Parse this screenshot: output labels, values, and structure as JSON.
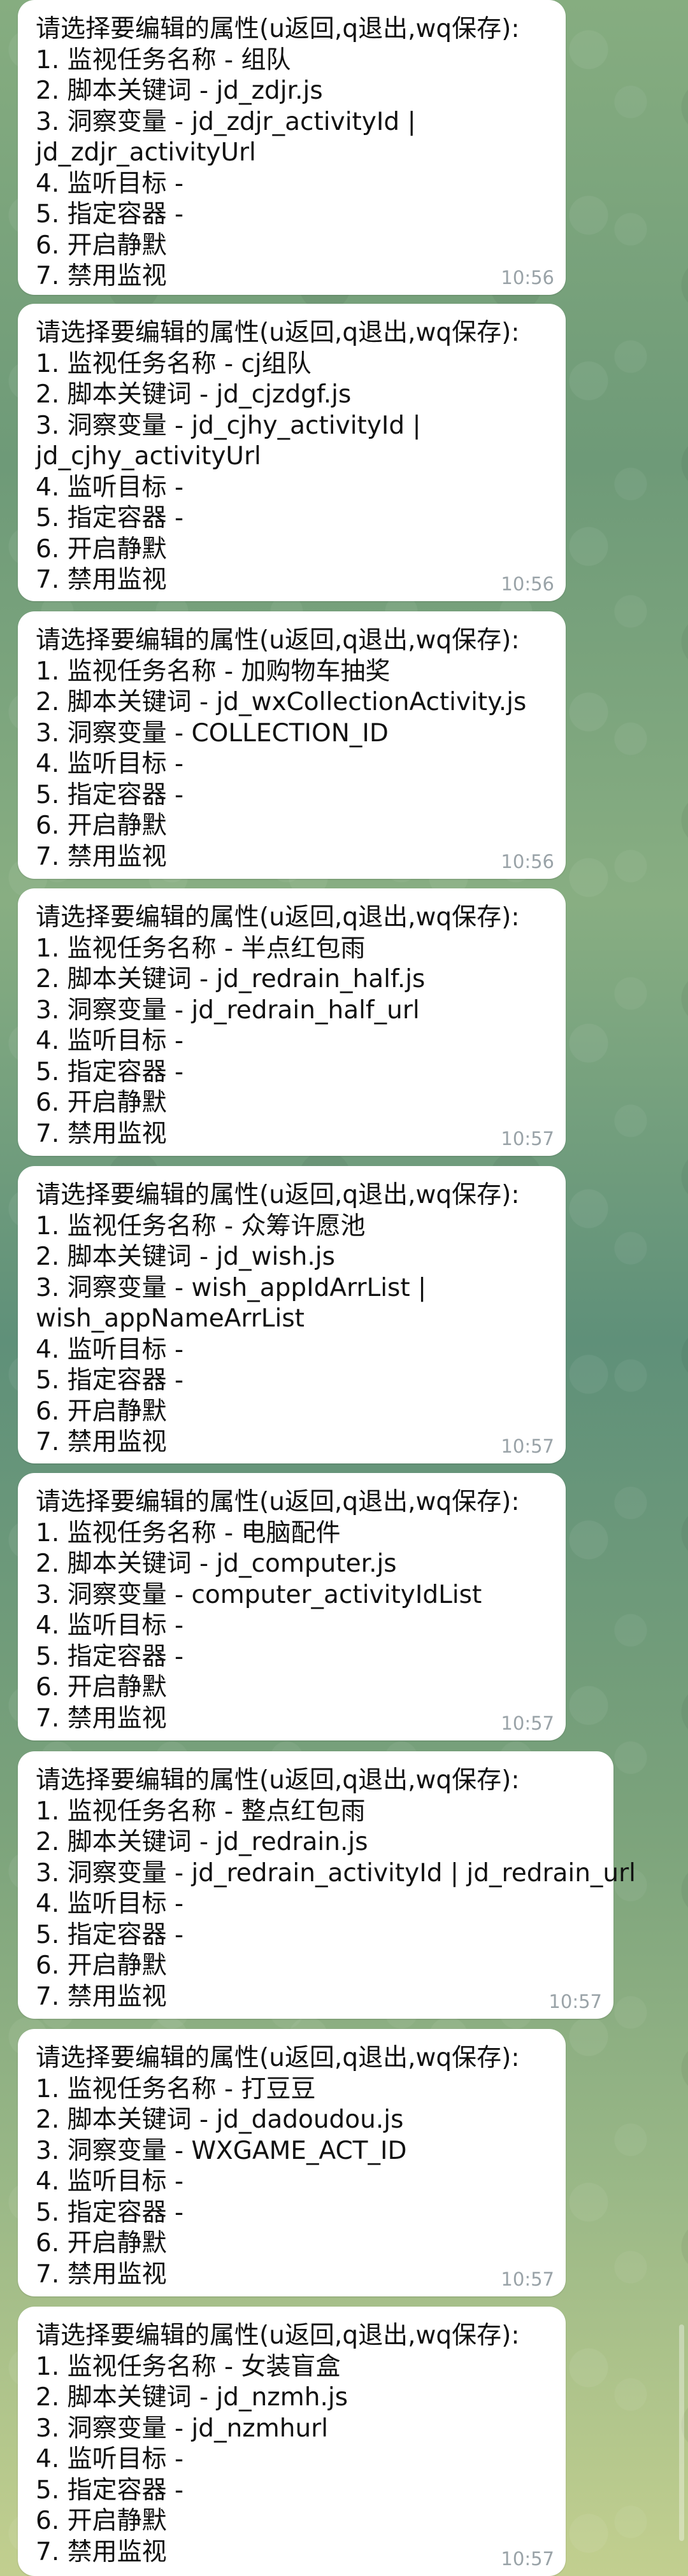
{
  "messages": [
    {
      "lines": [
        "请选择要编辑的属性(u返回,q退出,wq保存):",
        "1. 监视任务名称 - 组队",
        "2. 脚本关键词 - jd_zdjr.js",
        "3. 洞察变量 - jd_zdjr_activityId |",
        "jd_zdjr_activityUrl",
        "4. 监听目标 -",
        "5. 指定容器 -",
        "6. 开启静默",
        "7. 禁用监视"
      ],
      "time": "10:56"
    },
    {
      "lines": [
        "请选择要编辑的属性(u返回,q退出,wq保存):",
        "1. 监视任务名称 - cj组队",
        "2. 脚本关键词 - jd_cjzdgf.js",
        "3. 洞察变量 - jd_cjhy_activityId |",
        "jd_cjhy_activityUrl",
        "4. 监听目标 -",
        "5. 指定容器 -",
        "6. 开启静默",
        "7. 禁用监视"
      ],
      "time": "10:56"
    },
    {
      "lines": [
        "请选择要编辑的属性(u返回,q退出,wq保存):",
        "1. 监视任务名称 - 加购物车抽奖",
        "2. 脚本关键词 - jd_wxCollectionActivity.js",
        "3. 洞察变量 - COLLECTION_ID",
        "4. 监听目标 -",
        "5. 指定容器 -",
        "6. 开启静默",
        "7. 禁用监视"
      ],
      "time": "10:56"
    },
    {
      "lines": [
        "请选择要编辑的属性(u返回,q退出,wq保存):",
        "1. 监视任务名称 - 半点红包雨",
        "2. 脚本关键词 - jd_redrain_half.js",
        "3. 洞察变量 - jd_redrain_half_url",
        "4. 监听目标 -",
        "5. 指定容器 -",
        "6. 开启静默",
        "7. 禁用监视"
      ],
      "time": "10:57"
    },
    {
      "lines": [
        "请选择要编辑的属性(u返回,q退出,wq保存):",
        "1. 监视任务名称 - 众筹许愿池",
        "2. 脚本关键词 - jd_wish.js",
        "3. 洞察变量 - wish_appIdArrList |",
        "wish_appNameArrList",
        "4. 监听目标 -",
        "5. 指定容器 -",
        "6. 开启静默",
        "7. 禁用监视"
      ],
      "time": "10:57"
    },
    {
      "lines": [
        "请选择要编辑的属性(u返回,q退出,wq保存):",
        "1. 监视任务名称 - 电脑配件",
        "2. 脚本关键词 - jd_computer.js",
        "3. 洞察变量 - computer_activityIdList",
        "4. 监听目标 -",
        "5. 指定容器 -",
        "6. 开启静默",
        "7. 禁用监视"
      ],
      "time": "10:57"
    },
    {
      "lines": [
        "请选择要编辑的属性(u返回,q退出,wq保存):",
        "1. 监视任务名称 - 整点红包雨",
        "2. 脚本关键词 - jd_redrain.js",
        "3. 洞察变量 - jd_redrain_activityId | jd_redrain_url",
        "4. 监听目标 -",
        "5. 指定容器 -",
        "6. 开启静默",
        "7. 禁用监视"
      ],
      "time": "10:57"
    },
    {
      "lines": [
        "请选择要编辑的属性(u返回,q退出,wq保存):",
        "1. 监视任务名称 - 打豆豆",
        "2. 脚本关键词 - jd_dadoudou.js",
        "3. 洞察变量 - WXGAME_ACT_ID",
        "4. 监听目标 -",
        "5. 指定容器 -",
        "6. 开启静默",
        "7. 禁用监视"
      ],
      "time": "10:57"
    },
    {
      "lines": [
        "请选择要编辑的属性(u返回,q退出,wq保存):",
        "1. 监视任务名称 - 女装盲盒",
        "2. 脚本关键词 - jd_nzmh.js",
        "3. 洞察变量 - jd_nzmhurl",
        "4. 监听目标 -",
        "5. 指定容器 -",
        "6. 开启静默",
        "7. 禁用监视"
      ],
      "time": "10:57"
    }
  ]
}
